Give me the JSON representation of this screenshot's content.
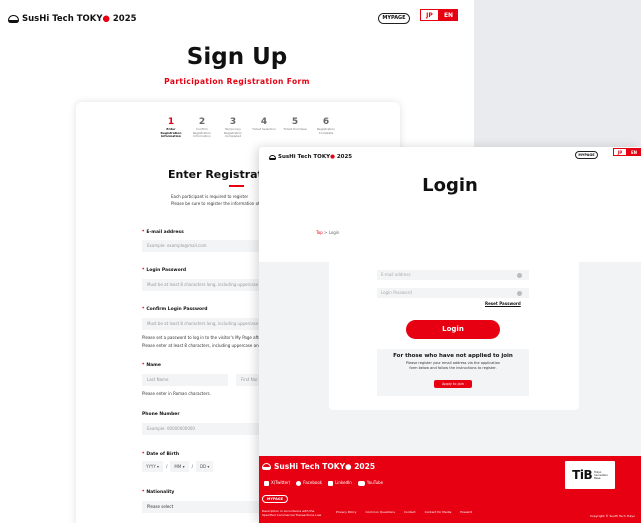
{
  "signup": {
    "logo": {
      "pre": "SusHi Tech T",
      "o": "O",
      "post": "KY",
      "dot": "●",
      "year": "2025"
    },
    "mypage": "MYPAGE",
    "lang": {
      "jp": "JP",
      "en": "EN"
    },
    "title": "Sign Up",
    "subtitle": "Participation Registration Form",
    "steps": [
      {
        "num": "1",
        "label": "Enter Registration Information"
      },
      {
        "num": "2",
        "label": "Confirm Registration Information"
      },
      {
        "num": "3",
        "label": "Temporary Registration Completed"
      },
      {
        "num": "4",
        "label": "Ticket Selection"
      },
      {
        "num": "5",
        "label": "Ticket Purchase"
      },
      {
        "num": "6",
        "label": "Registration Complete"
      }
    ],
    "heading": "Enter Registration In",
    "intro1": "Each participant is required to register",
    "intro2": "Please be sure to register the information of the p",
    "email_label": "E-mail address",
    "email_placeholder": "Example: example@mail.com",
    "password_label": "Login Password",
    "password_placeholder": "Must be at least 8 characters long, including uppercase and l",
    "confirm_label": "Confirm Login Password",
    "confirm_placeholder": "Must be at least 8 characters long, including uppercase and l",
    "pw_note1": "Please set a password to log in to the visitor's My Page after reg",
    "pw_note2": "Please enter at least 8 characters, including uppercase and low",
    "name_label": "Name",
    "last_name": "Last Name",
    "first_name": "First Nar",
    "name_note": "Please enter in Roman characters.",
    "phone_label": "Phone Number",
    "phone_placeholder": "Example: 00000000000",
    "dob_label": "Date of Birth",
    "dob_yyyy": "YYYY ▾",
    "dob_mm": "MM ▾",
    "dob_dd": "DD ▾",
    "dob_sep": "/",
    "nationality_label": "Nationality",
    "nationality_value": "Please select",
    "req_mark": "*"
  },
  "login": {
    "logo": {
      "pre": "SusHi Tech T",
      "o": "O",
      "post": "KY",
      "dot": "●",
      "year": "2025"
    },
    "mypage": "MYPAGE",
    "lang": {
      "jp": "JP",
      "en": "EN"
    },
    "title": "Login",
    "breadcrumb_top": "Top",
    "breadcrumb_sep": ">",
    "breadcrumb_current": "Login",
    "email_placeholder": "E-mail address",
    "password_placeholder": "Login Password",
    "reset_password": "Reset Password",
    "login_button": "Login",
    "not_applied_title": "For those who have not applied to join",
    "not_applied_text1": "Please register your email address via the application",
    "not_applied_text2": "form below and follow the instructions to register.",
    "apply_button": "Apply to join"
  },
  "footer": {
    "logo": {
      "pre": "SusHi Tech T",
      "o": "O",
      "post": "KY",
      "dot": "●",
      "year": "2025"
    },
    "social": [
      "X(Twitter)",
      "Facebook",
      "LinkedIn",
      "YouTube"
    ],
    "mypage": "MYPAGE",
    "legal": "Description in Accordance with the Specified Commercial Transactions Law",
    "links": [
      "Privacy Policy",
      "Common Questions",
      "Contact",
      "Contact for Media",
      "Presskit"
    ],
    "copyright": "Copyright © SusHi Tech Tokyo",
    "tib_big": "TiB",
    "tib_small": [
      "Tokyo",
      "Innovation",
      "Base"
    ]
  },
  "colors": {
    "accent": "#e60012",
    "bg": "#f2f3f5"
  }
}
